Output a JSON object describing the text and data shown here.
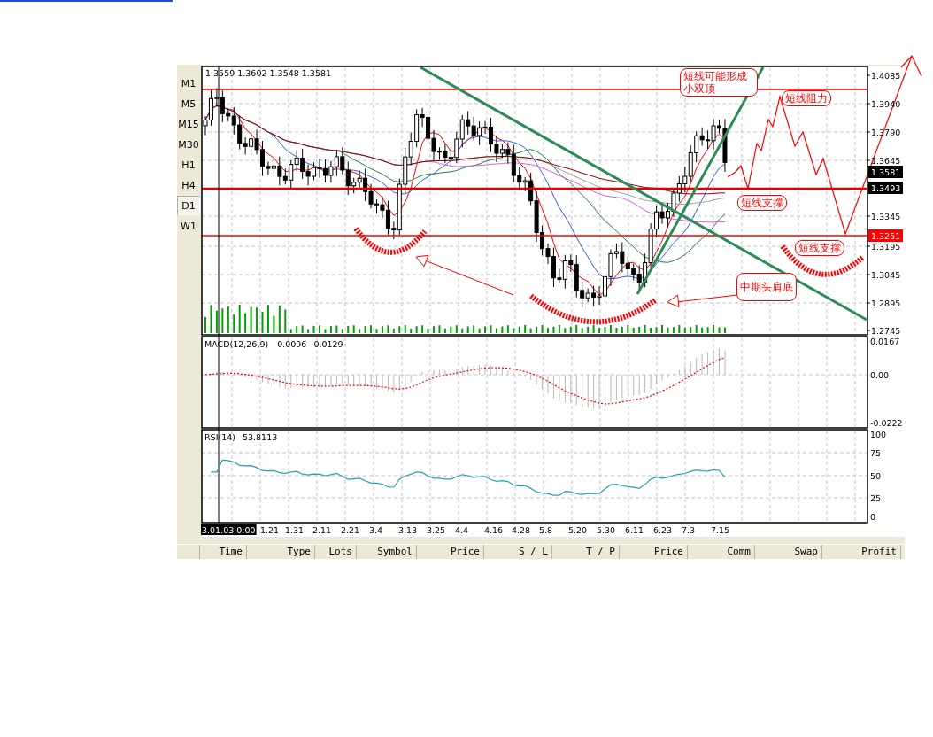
{
  "chart": {
    "ohlc": "1.3559 1.3602 1.3548 1.3581",
    "price_axis": [
      "1.4085",
      "1.3940",
      "1.3790",
      "1.3645",
      "1.3345",
      "1.3195",
      "1.3045",
      "1.2895",
      "1.2745"
    ],
    "price_badges": [
      {
        "label": "1.3581",
        "color": "#000000"
      },
      {
        "label": "1.3493",
        "color": "#000000"
      },
      {
        "label": "1.3251",
        "color": "#ff0000"
      }
    ],
    "annotations": [
      {
        "text": "短线可能形成小双顶"
      },
      {
        "text": "短线阻力"
      },
      {
        "text": "短线支撑"
      },
      {
        "text": "短线支撑"
      },
      {
        "text": "中期头肩底"
      }
    ],
    "macd": {
      "title": "MACD(12,26,9)",
      "values": [
        "0.0096",
        "0.0129"
      ],
      "axis": [
        "0.0167",
        "0.00",
        "-0.0222"
      ]
    },
    "rsi": {
      "title": "RSI(14)",
      "value": "53.8113",
      "axis": [
        "100",
        "75",
        "50",
        "25",
        "0"
      ]
    },
    "time_axis": [
      {
        "label": "3.01.03 0:00",
        "selected": true
      },
      {
        "label": "1.21",
        "selected": false
      },
      {
        "label": "1.31",
        "selected": false
      },
      {
        "label": "2.11",
        "selected": false
      },
      {
        "label": "2.21",
        "selected": false
      },
      {
        "label": "3.4",
        "selected": false
      },
      {
        "label": "3.13",
        "selected": false
      },
      {
        "label": "3.25",
        "selected": false
      },
      {
        "label": "4.4",
        "selected": false
      },
      {
        "label": "4.16",
        "selected": false
      },
      {
        "label": "4.28",
        "selected": false
      },
      {
        "label": "5.8",
        "selected": false
      },
      {
        "label": "5.20",
        "selected": false
      },
      {
        "label": "5.30",
        "selected": false
      },
      {
        "label": "6.11",
        "selected": false
      },
      {
        "label": "6.23",
        "selected": false
      },
      {
        "label": "7.3",
        "selected": false
      },
      {
        "label": "7.15",
        "selected": false
      }
    ]
  },
  "timeframes": [
    {
      "label": "M1",
      "selected": false
    },
    {
      "label": "M5",
      "selected": false
    },
    {
      "label": "M15",
      "selected": false
    },
    {
      "label": "M30",
      "selected": false
    },
    {
      "label": "H1",
      "selected": false
    },
    {
      "label": "H4",
      "selected": false
    },
    {
      "label": "D1",
      "selected": true
    },
    {
      "label": "W1",
      "selected": false
    }
  ],
  "columns": [
    "Time",
    "Type",
    "Lots",
    "Symbol",
    "Price",
    "S / L",
    "T / P",
    "Price",
    "Comm",
    "Swap",
    "Profit"
  ]
}
